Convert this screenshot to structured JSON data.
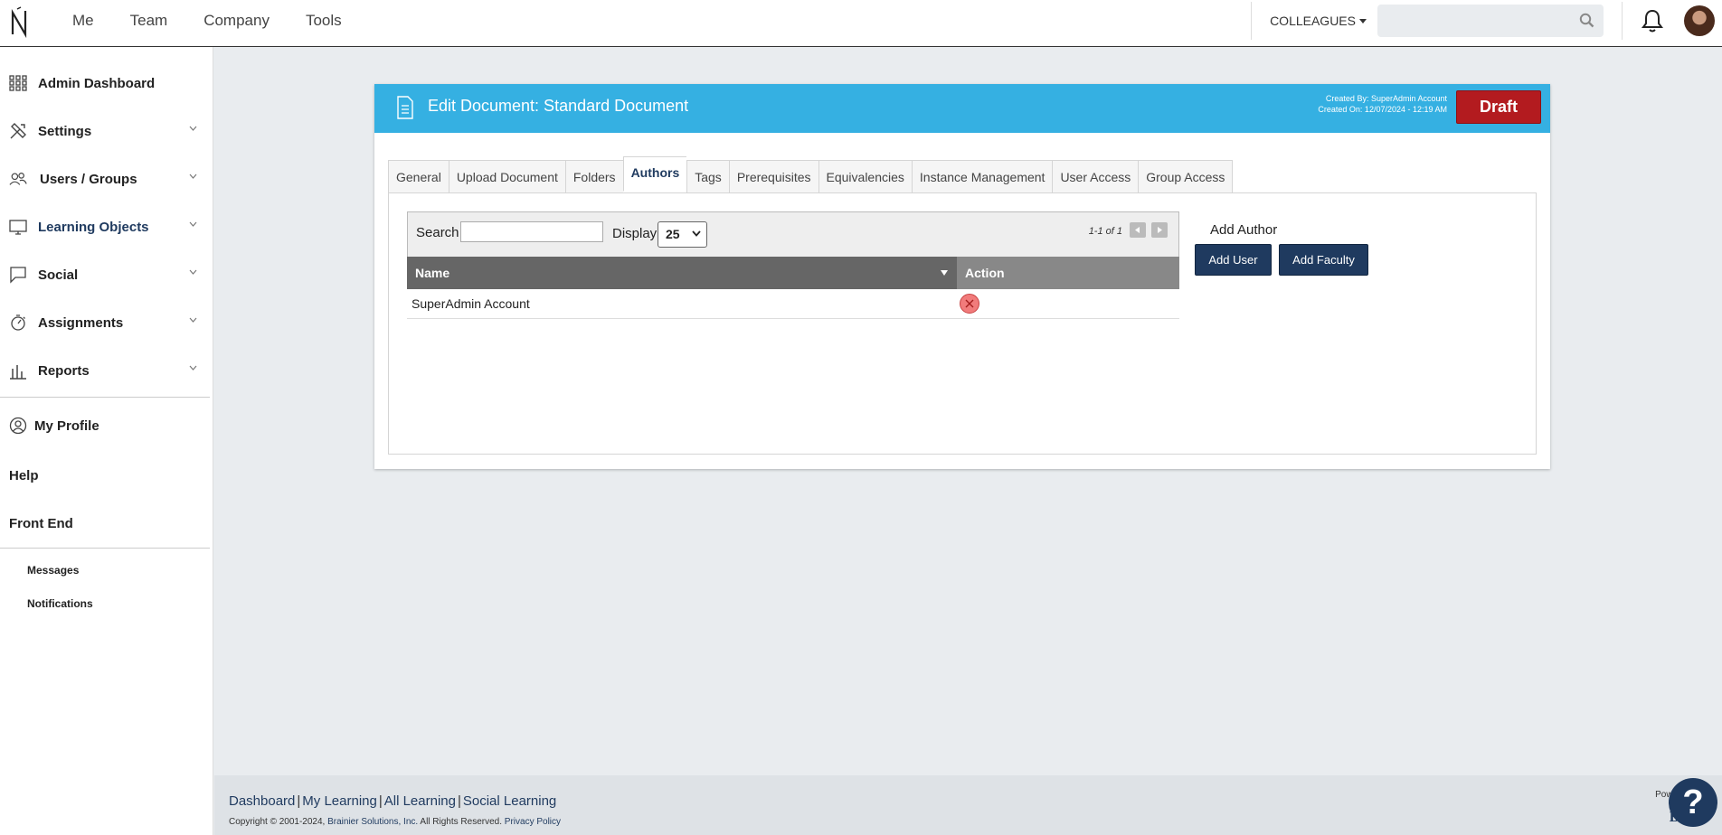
{
  "topnav": {
    "items": [
      "Me",
      "Team",
      "Company",
      "Tools"
    ],
    "colleagues_label": "COLLEAGUES",
    "search_value": ""
  },
  "sidebar": {
    "items": [
      {
        "label": "Admin Dashboard",
        "icon": "dashboard-grid-icon"
      },
      {
        "label": "Settings",
        "icon": "tools-icon"
      },
      {
        "label": "Users / Groups",
        "icon": "users-icon"
      },
      {
        "label": "Learning Objects",
        "icon": "monitor-icon"
      },
      {
        "label": "Social",
        "icon": "chat-bubble-icon"
      },
      {
        "label": "Assignments",
        "icon": "stopwatch-icon"
      },
      {
        "label": "Reports",
        "icon": "bar-chart-icon"
      }
    ],
    "my_profile": "My Profile",
    "help": "Help",
    "front_end": "Front End",
    "messages": "Messages",
    "notifications": "Notifications"
  },
  "card": {
    "title": "Edit Document: Standard Document",
    "created_by": "Created By: SuperAdmin Account",
    "created_on": "Created On: 12/07/2024 - 12:19 AM",
    "status": "Draft",
    "tabs": [
      "General",
      "Upload Document",
      "Folders",
      "Authors",
      "Tags",
      "Prerequisites",
      "Equivalencies",
      "Instance Management",
      "User Access",
      "Group Access"
    ],
    "active_tab": "Authors"
  },
  "grid": {
    "search_label": "Search",
    "search_value": "",
    "display_label": "Display",
    "display_value": "25",
    "pager": "1-1 of 1",
    "columns": [
      "Name",
      "Action"
    ],
    "rows": [
      {
        "name": "SuperAdmin Account"
      }
    ]
  },
  "add_author": {
    "title": "Add Author",
    "add_user": "Add User",
    "add_faculty": "Add Faculty"
  },
  "footer": {
    "links": [
      "Dashboard",
      "My Learning",
      "All Learning",
      "Social Learning"
    ],
    "copyright": "Copyright © 2001-2024,",
    "company": "Brainier Solutions, Inc.",
    "rights": "All Rights Reserved.",
    "privacy": "Privacy Policy",
    "powered": "Powere",
    "brand": "Brai"
  },
  "colors": {
    "header_blue": "#35b0e2",
    "draft_red": "#b31b1f",
    "navy": "#1f3a5f"
  }
}
